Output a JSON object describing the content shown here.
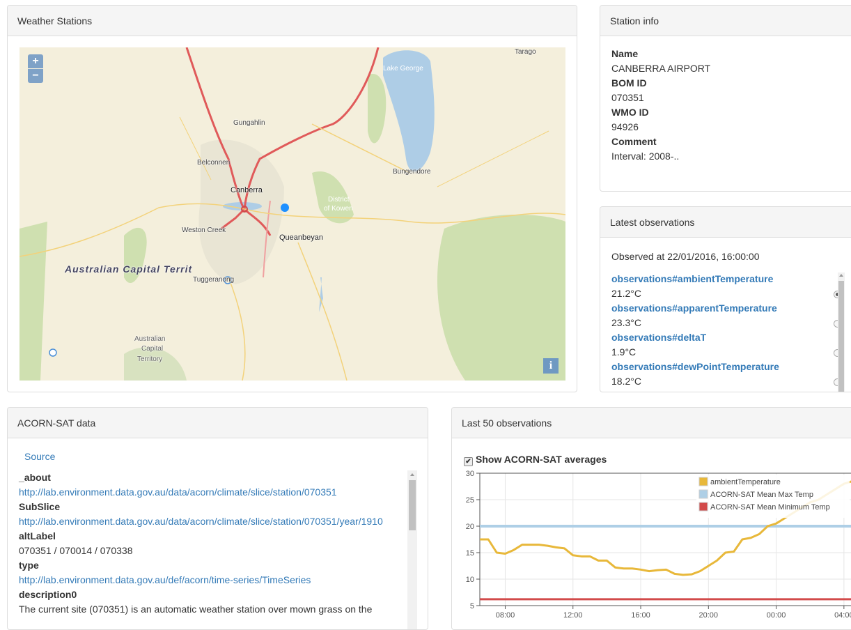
{
  "weather_panel": {
    "title": "Weather Stations",
    "zoom_in": "+",
    "zoom_out": "−",
    "info_button": "i",
    "map_labels": [
      "Tarago",
      "Lake George",
      "Gungahlin",
      "Belconnen",
      "Bungendore",
      "Canberra",
      "District",
      "of Kowen",
      "Weston Creek",
      "Queanbeyan",
      "Australian Capital Territ",
      "Tuggeranong",
      "Australian",
      "Capital",
      "Territory"
    ]
  },
  "station_info": {
    "title": "Station info",
    "name_label": "Name",
    "name": "CANBERRA AIRPORT",
    "bom_label": "BOM ID",
    "bom": "070351",
    "wmo_label": "WMO ID",
    "wmo": "94926",
    "comment_label": "Comment",
    "comment": "Interval: 2008-.."
  },
  "latest": {
    "title": "Latest observations",
    "observed": "Observed at 22/01/2016, 16:00:00",
    "items": [
      {
        "label": "observations#ambientTemperature",
        "value": "21.2°C"
      },
      {
        "label": "observations#apparentTemperature",
        "value": "23.3°C"
      },
      {
        "label": "observations#deltaT",
        "value": "1.9°C"
      },
      {
        "label": "observations#dewPointTemperature",
        "value": "18.2°C"
      }
    ]
  },
  "acorn": {
    "title": "ACORN-SAT data",
    "source": "Source",
    "about_label": "_about",
    "about": "http://lab.environment.data.gov.au/data/acorn/climate/slice/station/070351",
    "subslice_label": "SubSlice",
    "subslice": "http://lab.environment.data.gov.au/data/acorn/climate/slice/station/070351/year/1910",
    "altlabel_label": "altLabel",
    "altlabel": "070351 / 070014 / 070338",
    "type_label": "type",
    "type": "http://lab.environment.data.gov.au/def/acorn/time-series/TimeSeries",
    "desc_label": "description0",
    "desc": "The current site (070351) is an automatic weather station over mown grass on the"
  },
  "last50": {
    "title": "Last 50 observations",
    "checkbox_label": "Show ACORN-SAT averages"
  },
  "colors": {
    "ambient": "#e8b83a",
    "max": "#aecfe6",
    "min": "#d24a4a"
  },
  "chart_data": {
    "type": "line",
    "title": "",
    "xlabel": "",
    "ylabel": "",
    "ylim": [
      5,
      30
    ],
    "yticks": [
      5,
      10,
      15,
      20,
      25,
      30
    ],
    "x_ticks": [
      "08:00",
      "12:00",
      "16:00",
      "20:00",
      "00:00",
      "04:00"
    ],
    "x_tick_hours": [
      8,
      12,
      16,
      20,
      24,
      28
    ],
    "xlim": [
      6.5,
      28.5
    ],
    "legend_position": "top-right",
    "series": [
      {
        "name": "ambientTemperature",
        "x": [
          6.5,
          7,
          7.5,
          8,
          8.5,
          9,
          10,
          10.5,
          11,
          11.5,
          12,
          12.5,
          13,
          13.5,
          14,
          14.5,
          15,
          15.5,
          16,
          16.5,
          17,
          17.5,
          18,
          18.5,
          19,
          19.5,
          20,
          20.5,
          21,
          21.5,
          22,
          22.5,
          23,
          23.5,
          24,
          24.5,
          25,
          25.5,
          26,
          26.5,
          27,
          27.5,
          28,
          28.5
        ],
        "values": [
          17.5,
          17.5,
          15,
          14.8,
          15.5,
          16.5,
          16.5,
          16.3,
          16,
          15.8,
          14.5,
          14.3,
          14.3,
          13.5,
          13.5,
          12.2,
          12,
          12,
          11.8,
          11.5,
          11.7,
          11.8,
          11,
          10.8,
          10.9,
          11.5,
          12.5,
          13.5,
          15,
          15.2,
          17.5,
          17.8,
          18.5,
          20,
          20.5,
          21.5,
          22.5,
          23.5,
          24.5,
          25,
          26,
          27,
          28,
          28.5
        ]
      },
      {
        "name": "ACORN-SAT Mean Max Temp",
        "x": [
          6.5,
          28.5
        ],
        "values": [
          20,
          20
        ]
      },
      {
        "name": "ACORN-SAT Mean Minimum Temp",
        "x": [
          6.5,
          28.5
        ],
        "values": [
          6.2,
          6.2
        ]
      }
    ]
  }
}
